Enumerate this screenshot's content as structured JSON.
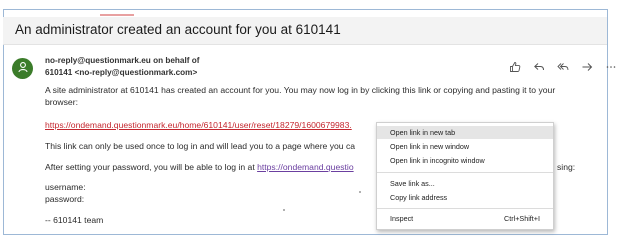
{
  "email": {
    "subject": "An administrator created an account for you at 610141",
    "sender_line1": "no-reply@questionmark.eu on behalf of",
    "sender_line2": "610141 <no-reply@questionmark.com>",
    "para1_line1": "A site administrator at 610141 has created an account for you. You may now log in by clicking this link or copying and pasting it to your",
    "para1_line2": "browser:",
    "reset_link": "https://ondemand.questionmark.eu/home/610141/user/reset/18279/1600679983.",
    "para2": "This link can only be used once to log in and will lead you to a page where you ca",
    "para3_prefix": "After setting your password, you will be able to log in at ",
    "para3_link": "https://ondemand.questio",
    "para3_suffix": "sing:",
    "username_label": "username:",
    "password_label": "password:",
    "signature": "-- 610141 team"
  },
  "context_menu": {
    "items": [
      {
        "label": "Open link in new tab",
        "shortcut": ""
      },
      {
        "label": "Open link in new window",
        "shortcut": ""
      },
      {
        "label": "Open link in incognito window",
        "shortcut": ""
      },
      {
        "label": "Save link as...",
        "shortcut": ""
      },
      {
        "label": "Copy link address",
        "shortcut": ""
      },
      {
        "label": "Inspect",
        "shortcut": "Ctrl+Shift+I"
      }
    ]
  },
  "icons": {
    "avatar": "person-icon",
    "react": "thumbs-up-icon",
    "reply": "reply-icon",
    "reply_all": "reply-all-icon",
    "forward": "forward-icon",
    "more": "more-icon"
  },
  "colors": {
    "avatar_bg": "#3b7c2a",
    "link_red": "#c4262e",
    "link_purple": "#6b3fa0"
  }
}
